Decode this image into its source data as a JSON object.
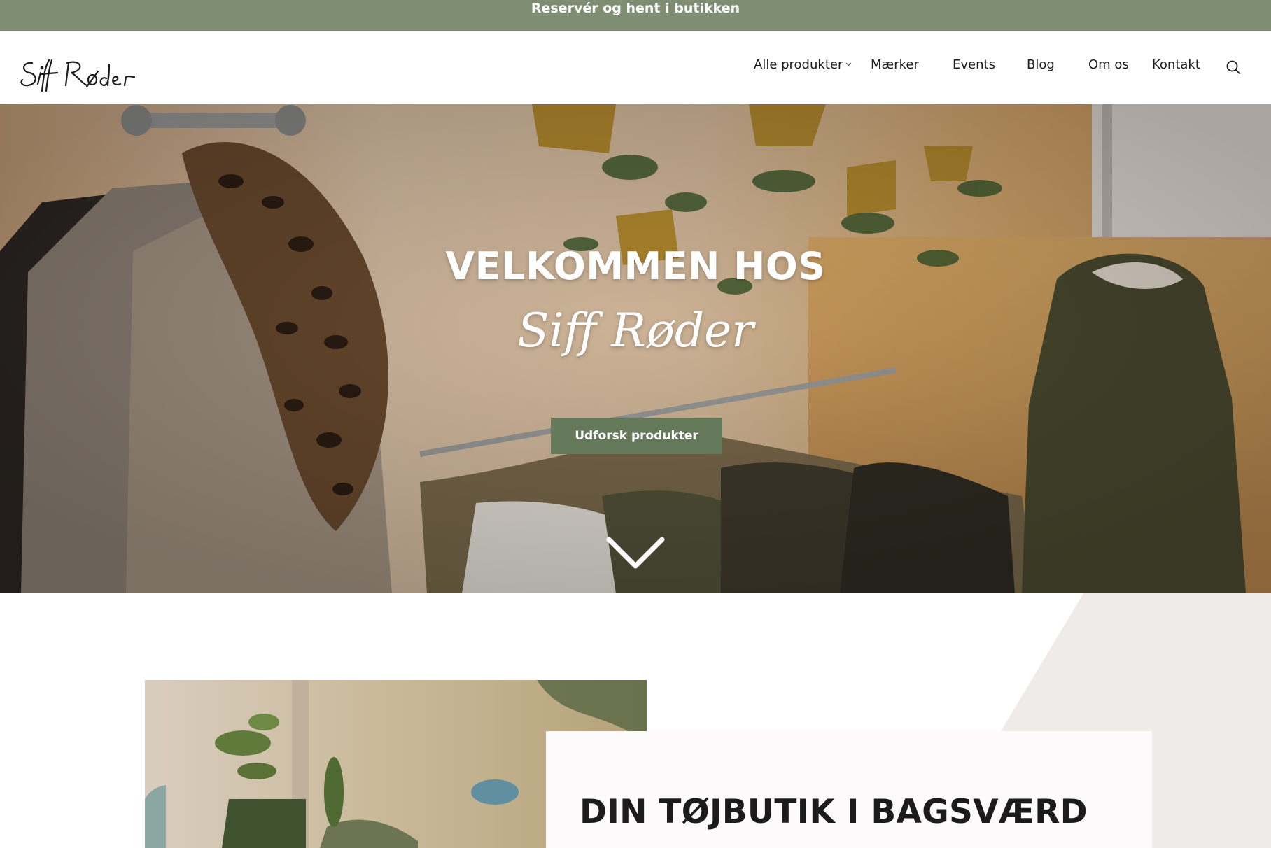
{
  "announcement": {
    "text": "Reservér og hent i butikken"
  },
  "header": {
    "logo_text": "Siff Røder",
    "nav": [
      {
        "label": "Alle produkter",
        "has_dropdown": true
      },
      {
        "label": "Mærker"
      },
      {
        "label": "Events"
      },
      {
        "label": "Blog"
      },
      {
        "label": "Om os"
      },
      {
        "label": "Kontakt"
      }
    ],
    "search_icon": "search-icon"
  },
  "hero": {
    "title": "VELKOMMEN HOS",
    "script": "Siff Røder",
    "cta_label": "Udforsk produkter",
    "scroll_icon": "chevron-down-icon"
  },
  "intro": {
    "title": "DIN TØJBUTIK I BAGSVÆRD"
  },
  "colors": {
    "brand_green": "#7f8d73",
    "cta_green": "#64795a",
    "shape_beige": "#efebe8"
  }
}
